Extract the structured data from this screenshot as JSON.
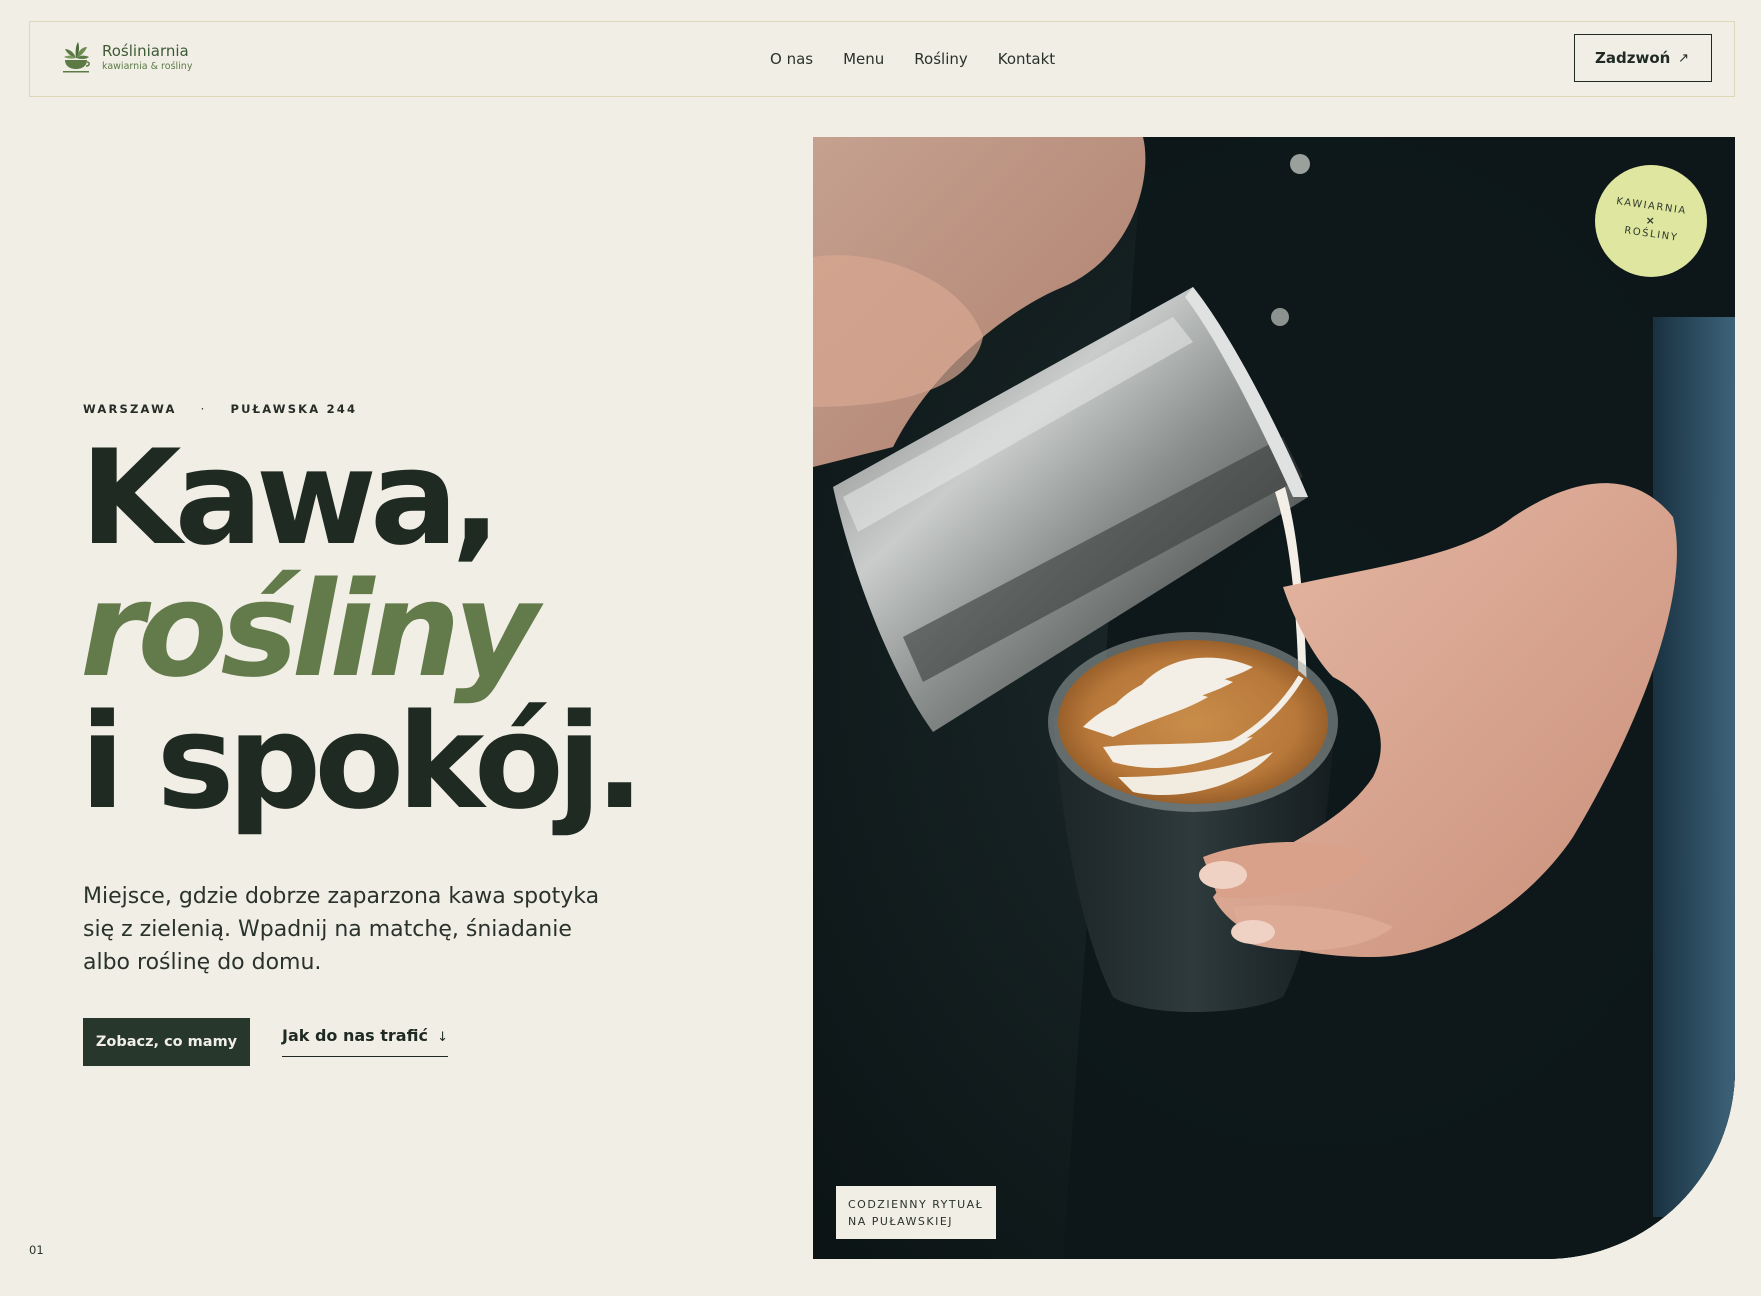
{
  "brand": {
    "name": "Rośliniarnia",
    "tagline": "kawiarnia & rośliny"
  },
  "nav": {
    "items": [
      "O nas",
      "Menu",
      "Rośliny",
      "Kontakt"
    ]
  },
  "header": {
    "call_label": "Zadzwoń",
    "call_icon": "arrow-up-right-icon"
  },
  "hero": {
    "city": "WARSZAWA",
    "separator": "·",
    "address": "PUŁAWSKA 244",
    "headline_line1": "Kawa,",
    "headline_line2": "rośliny",
    "headline_line3": "i spokój.",
    "lead": "Miejsce, gdzie dobrze zaparzona kawa spotyka się z zielenią. Wpadnij na matchę, śniadanie albo roślinę do domu.",
    "primary_cta": "Zobacz, co mamy",
    "secondary_cta": "Jak do nas trafić",
    "secondary_icon": "arrow-down-icon"
  },
  "stamp": {
    "line1": "KAWIARNIA",
    "mark": "×",
    "line2": "ROŚLINY"
  },
  "caption": {
    "line1": "CODZIENNY RYTUAŁ",
    "line2": "NA PUŁAWSKIEJ"
  },
  "page_number": "01",
  "colors": {
    "background": "#f1eee6",
    "accent_green": "#637a4a",
    "dark": "#1f2a22",
    "button": "#27372c",
    "stamp": "#dfe6a0"
  }
}
